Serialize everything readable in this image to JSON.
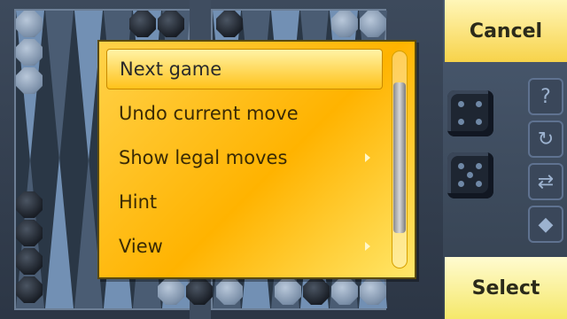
{
  "menu": {
    "items": [
      {
        "label": "Next game",
        "selected": true,
        "has_submenu": false
      },
      {
        "label": "Undo current move",
        "selected": false,
        "has_submenu": false
      },
      {
        "label": "Show legal moves",
        "selected": false,
        "has_submenu": true
      },
      {
        "label": "Hint",
        "selected": false,
        "has_submenu": false
      },
      {
        "label": "View",
        "selected": false,
        "has_submenu": true
      }
    ]
  },
  "softkeys": {
    "top": "Cancel",
    "bottom": "Select"
  },
  "toolbar": {
    "icons": [
      "help-icon",
      "rotate-icon",
      "swap-icon",
      "diamond-icon"
    ]
  },
  "dice": [
    {
      "value": 4
    },
    {
      "value": 5
    }
  ],
  "colors": {
    "menu_gradient_start": "#ffd24a",
    "menu_gradient_end": "#ffe76a",
    "softkey_bg": "#f7d34a",
    "board_bg": "#2a3746"
  }
}
